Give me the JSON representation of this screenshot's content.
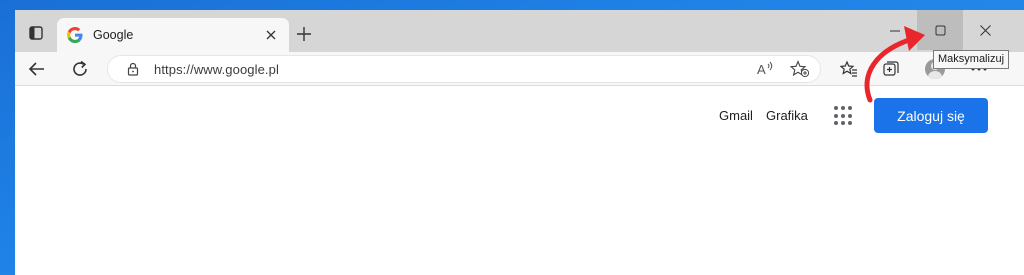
{
  "tab": {
    "title": "Google",
    "favicon": "google-g-icon"
  },
  "window": {
    "tooltip": "Maksymalizuj"
  },
  "toolbar": {
    "url": "https://www.google.pl"
  },
  "page": {
    "links": [
      "Gmail",
      "Grafika"
    ],
    "signin_label": "Zaloguj się"
  },
  "colors": {
    "signin_bg": "#1a73e8",
    "annotation_arrow": "#e8262b",
    "desktop": "#1f82e6"
  },
  "icons": {
    "tab_actions": "tab-actions-icon",
    "new_tab": "plus-icon",
    "minimize": "minimize-icon",
    "maximize": "maximize-icon",
    "close": "close-icon",
    "back": "back-arrow-icon",
    "reload": "reload-icon",
    "lock": "lock-icon",
    "read_aloud": "read-aloud-icon",
    "add_favorite": "star-plus-icon",
    "favorites": "favorites-icon",
    "collections": "collections-icon",
    "profile": "profile-avatar-icon",
    "more": "more-dots-icon",
    "apps": "apps-grid-icon"
  }
}
